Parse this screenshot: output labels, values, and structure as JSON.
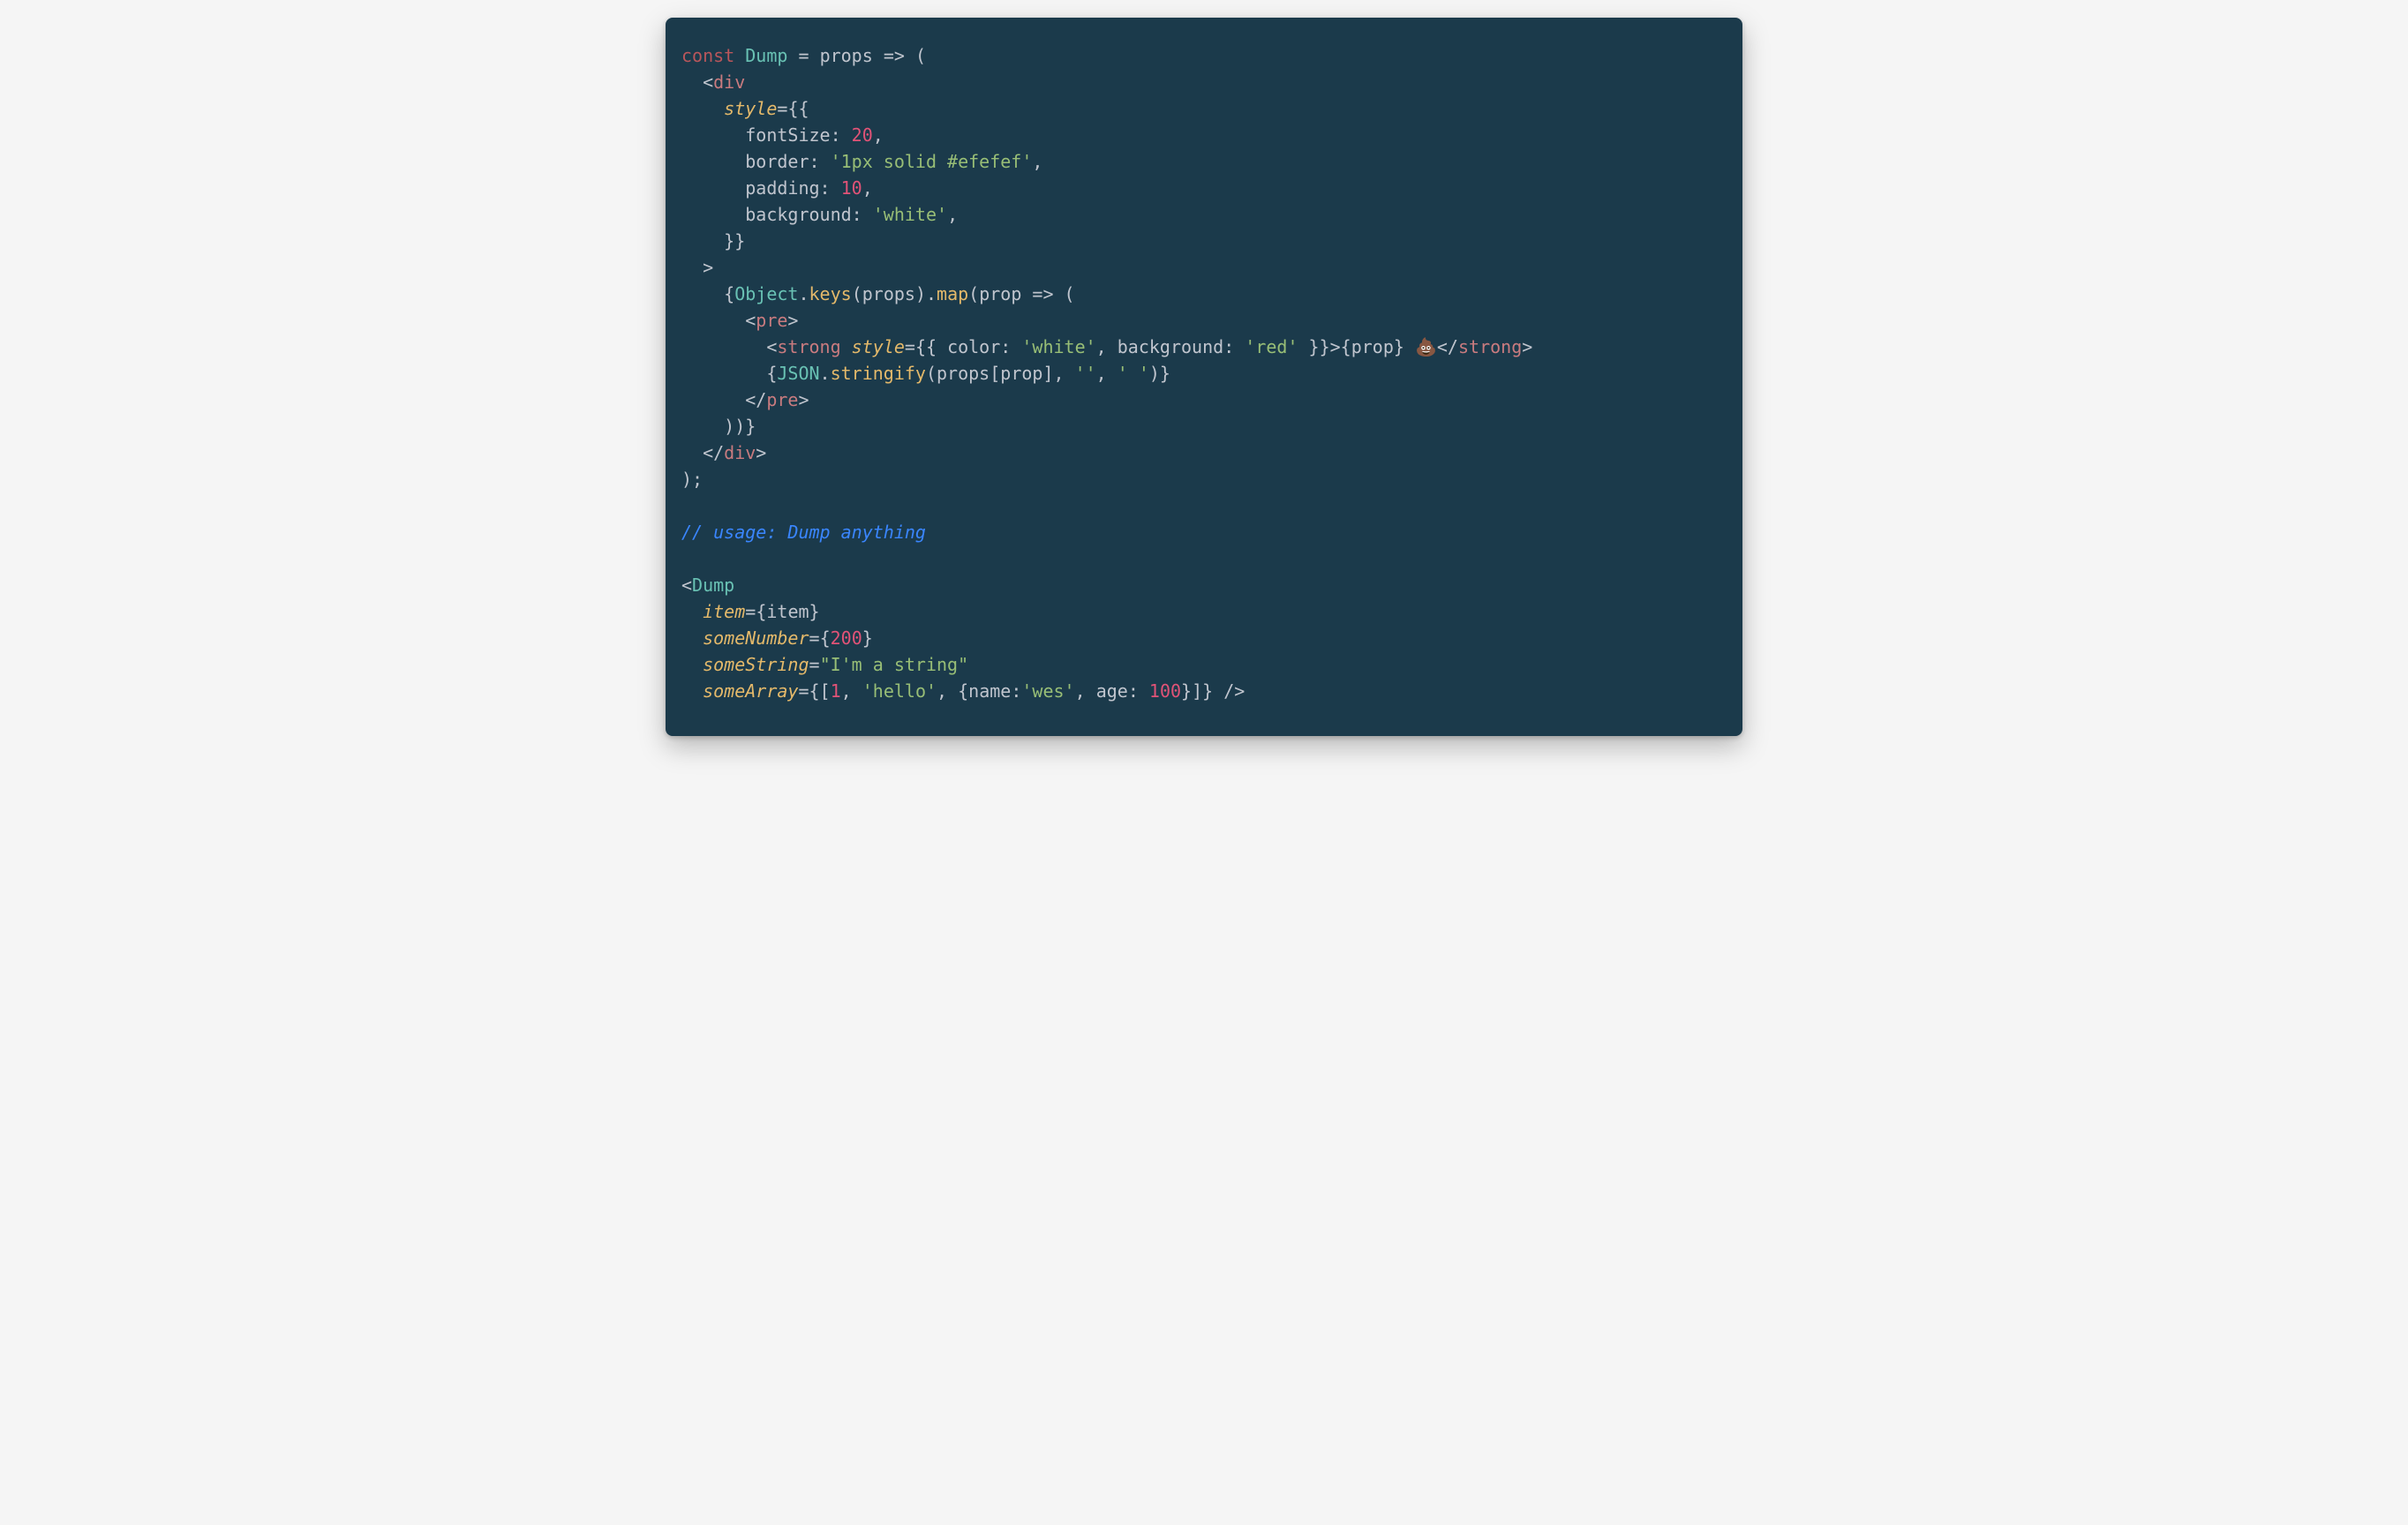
{
  "tokens": {
    "l1_const": "const",
    "l1_dump": "Dump",
    "l1_eq": " = ",
    "l1_props": "props",
    "l1_arrow": " => ",
    "l1_open": "(",
    "l2_open": "  <",
    "l2_div": "div",
    "l3_indent": "    ",
    "l3_style": "style",
    "l3_eq": "=",
    "l3_brace": "{{",
    "l4_indent": "      ",
    "l4_key": "fontSize",
    "l4_colon": ": ",
    "l4_val": "20",
    "l4_comma": ",",
    "l5_indent": "      ",
    "l5_key": "border",
    "l5_colon": ": ",
    "l5_val": "'1px solid #efefef'",
    "l5_comma": ",",
    "l6_indent": "      ",
    "l6_key": "padding",
    "l6_colon": ": ",
    "l6_val": "10",
    "l6_comma": ",",
    "l7_indent": "      ",
    "l7_key": "background",
    "l7_colon": ": ",
    "l7_val": "'white'",
    "l7_comma": ",",
    "l8_close": "    }}",
    "l9_close": "  >",
    "l10_indent": "    {",
    "l10_obj": "Object",
    "l10_dot1": ".",
    "l10_keys": "keys",
    "l10_paren1": "(",
    "l10_props": "props",
    "l10_paren2": ").",
    "l10_map": "map",
    "l10_paren3": "(",
    "l10_prop": "prop",
    "l10_arrow": " => (",
    "l11_open": "      <",
    "l11_pre": "pre",
    "l11_gt": ">",
    "l12_open": "        <",
    "l12_strong": "strong",
    "l12_sp": " ",
    "l12_style": "style",
    "l12_eq": "=",
    "l12_brace1": "{{ ",
    "l12_color_k": "color",
    "l12_color_c": ": ",
    "l12_color_v": "'white'",
    "l12_comma1": ", ",
    "l12_bg_k": "background",
    "l12_bg_c": ": ",
    "l12_bg_v": "'red'",
    "l12_brace2": " }}",
    "l12_gt": ">",
    "l12_expr_open": "{",
    "l12_prop": "prop",
    "l12_expr_close": "}",
    "l12_sp2": " ",
    "l12_emoji": "💩",
    "l12_close": "</",
    "l12_strong2": "strong",
    "l12_gt2": ">",
    "l13_open": "        {",
    "l13_json": "JSON",
    "l13_dot": ".",
    "l13_stringify": "stringify",
    "l13_p1": "(",
    "l13_props": "props",
    "l13_br1": "[",
    "l13_prop": "prop",
    "l13_br2": "], ",
    "l13_s1": "''",
    "l13_c1": ", ",
    "l13_s2": "' '",
    "l13_close": ")}",
    "l14_close": "      </",
    "l14_pre": "pre",
    "l14_gt": ">",
    "l15_close": "    ))}",
    "l16_close": "  </",
    "l16_div": "div",
    "l16_gt": ">",
    "l17_close": ");",
    "l19_comment": "// usage: Dump anything",
    "l21_open": "<",
    "l21_dump": "Dump",
    "l22_indent": "  ",
    "l22_attr": "item",
    "l22_eq": "=",
    "l22_brace": "{",
    "l22_val": "item",
    "l22_close": "}",
    "l23_indent": "  ",
    "l23_attr": "someNumber",
    "l23_eq": "=",
    "l23_brace": "{",
    "l23_val": "200",
    "l23_close": "}",
    "l24_indent": "  ",
    "l24_attr": "someString",
    "l24_eq": "=",
    "l24_val": "\"I'm a string\"",
    "l25_indent": "  ",
    "l25_attr": "someArray",
    "l25_eq": "=",
    "l25_open": "{[",
    "l25_n1": "1",
    "l25_c1": ", ",
    "l25_s1": "'hello'",
    "l25_c2": ", {",
    "l25_k1": "name",
    "l25_colon1": ":",
    "l25_v1": "'wes'",
    "l25_c3": ", ",
    "l25_k2": "age",
    "l25_colon2": ": ",
    "l25_v2": "100",
    "l25_close_obj": "}]} />"
  }
}
